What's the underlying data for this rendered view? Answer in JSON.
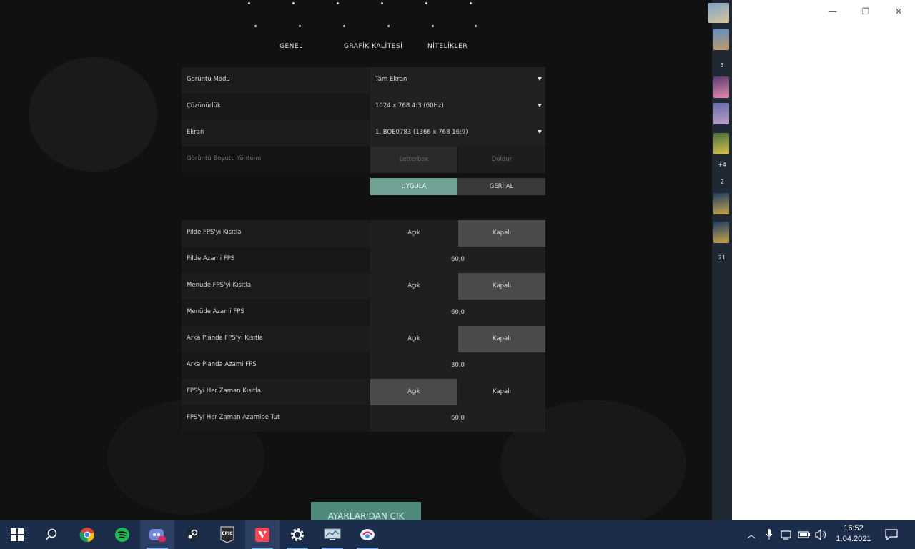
{
  "tabs": [
    "GENEL",
    "GRAFİK KALİTESİ",
    "NİTELİKLER"
  ],
  "display": {
    "mode": {
      "label": "Görüntü Modu",
      "value": "Tam Ekran"
    },
    "resolution": {
      "label": "Çözünürlük",
      "value": "1024 x 768 4:3 (60Hz)"
    },
    "monitor": {
      "label": "Ekran",
      "value": "1. BOE0783 (1366 x 768 16:9)"
    },
    "aspect": {
      "label": "Görüntü Boyutu Yöntemi",
      "opt1": "Letterbox",
      "opt2": "Doldur"
    },
    "apply": "UYGULA",
    "revert": "GERİ AL"
  },
  "fps": {
    "on": "Açık",
    "off": "Kapalı",
    "limit_in_game": "Pilde FPS'yi Kısıtla",
    "max_in_game": "Pilde Azami FPS",
    "max_in_game_value": "60,0",
    "limit_menu": "Menüde FPS'yi Kısıtla",
    "max_menu": "Menüde Azami FPS",
    "max_menu_value": "60,0",
    "limit_background": "Arka Planda FPS'yi Kısıtla",
    "max_background": "Arka Planda Azami FPS",
    "max_background_value": "30,0",
    "limit_always": "FPS'yi Her Zaman Kısıtla",
    "max_always": "FPS'yi Her Zaman Azamide Tut",
    "max_always_value": "60,0"
  },
  "exit_button": "AYARLAR'DAN ÇIK",
  "sidebar": {
    "counts": [
      "3",
      "+4",
      "2",
      "21"
    ]
  },
  "window_controls": {
    "minimize": "—",
    "restore": "❐",
    "close": "✕"
  },
  "taskbar": {
    "apps": [
      "windows-start",
      "search",
      "chrome",
      "spotify",
      "discord",
      "steam",
      "epic-games",
      "valorant",
      "settings",
      "display",
      "ideas"
    ],
    "time": "16:52",
    "date": "1.04.2021",
    "accent": "#1c2d4c"
  }
}
